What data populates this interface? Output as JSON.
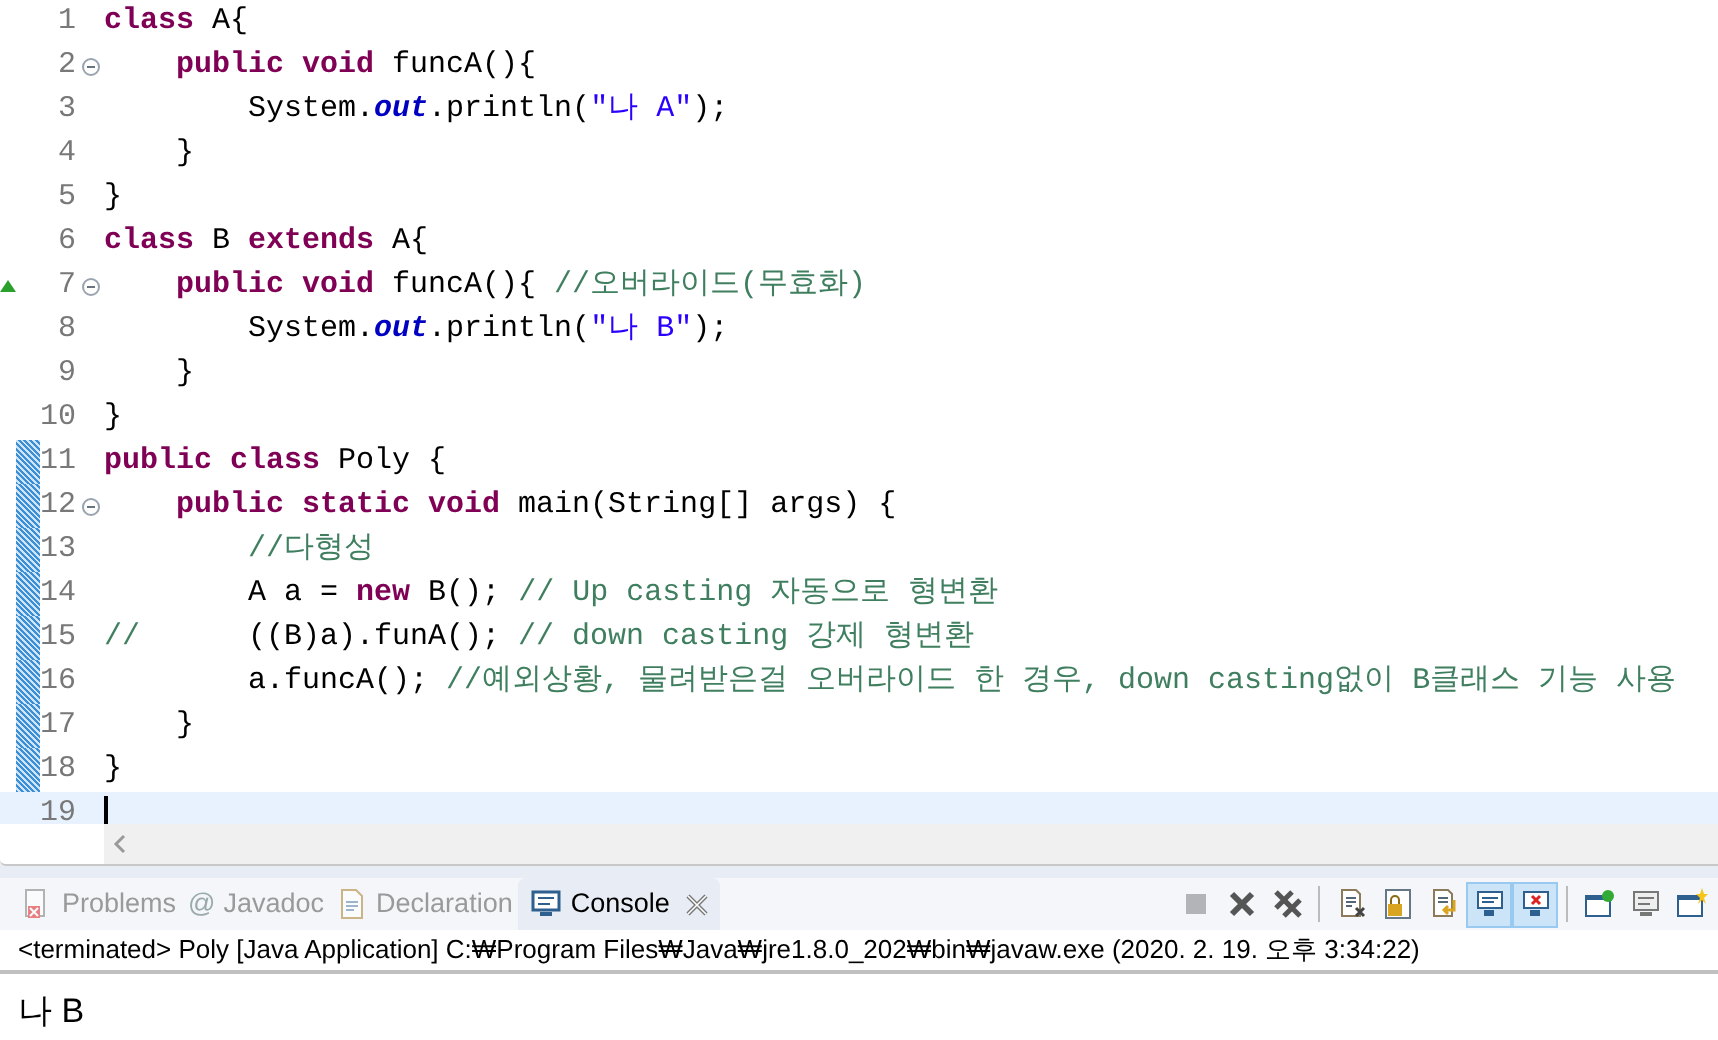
{
  "editor": {
    "lines": [
      {
        "number": "1",
        "fold": false,
        "override": false,
        "changed": false,
        "current": false,
        "tokens": [
          {
            "kind": "keyword",
            "text": "class"
          },
          {
            "kind": "plain",
            "text": " A{"
          }
        ]
      },
      {
        "number": "2",
        "fold": true,
        "override": false,
        "changed": false,
        "current": false,
        "tokens": [
          {
            "kind": "keyword",
            "text": "    public void"
          },
          {
            "kind": "plain",
            "text": " funcA(){"
          }
        ]
      },
      {
        "number": "3",
        "fold": false,
        "override": false,
        "changed": false,
        "current": false,
        "tokens": [
          {
            "kind": "plain",
            "text": "        System."
          },
          {
            "kind": "field",
            "text": "out"
          },
          {
            "kind": "plain",
            "text": ".println("
          },
          {
            "kind": "string",
            "text": "\"나 A\""
          },
          {
            "kind": "plain",
            "text": ");"
          }
        ]
      },
      {
        "number": "4",
        "fold": false,
        "override": false,
        "changed": false,
        "current": false,
        "tokens": [
          {
            "kind": "plain",
            "text": "    }"
          }
        ]
      },
      {
        "number": "5",
        "fold": false,
        "override": false,
        "changed": false,
        "current": false,
        "tokens": [
          {
            "kind": "plain",
            "text": "}"
          }
        ]
      },
      {
        "number": "6",
        "fold": false,
        "override": false,
        "changed": false,
        "current": false,
        "tokens": [
          {
            "kind": "keyword",
            "text": "class"
          },
          {
            "kind": "plain",
            "text": " B "
          },
          {
            "kind": "keyword",
            "text": "extends"
          },
          {
            "kind": "plain",
            "text": " A{"
          }
        ]
      },
      {
        "number": "7",
        "fold": true,
        "override": true,
        "changed": false,
        "current": false,
        "tokens": [
          {
            "kind": "keyword",
            "text": "    public void"
          },
          {
            "kind": "plain",
            "text": " funcA(){ "
          },
          {
            "kind": "comment",
            "text": "//오버라이드(무효화)"
          }
        ]
      },
      {
        "number": "8",
        "fold": false,
        "override": false,
        "changed": false,
        "current": false,
        "tokens": [
          {
            "kind": "plain",
            "text": "        System."
          },
          {
            "kind": "field",
            "text": "out"
          },
          {
            "kind": "plain",
            "text": ".println("
          },
          {
            "kind": "string",
            "text": "\"나 B\""
          },
          {
            "kind": "plain",
            "text": ");"
          }
        ]
      },
      {
        "number": "9",
        "fold": false,
        "override": false,
        "changed": false,
        "current": false,
        "tokens": [
          {
            "kind": "plain",
            "text": "    }"
          }
        ]
      },
      {
        "number": "10",
        "fold": false,
        "override": false,
        "changed": false,
        "current": false,
        "tokens": [
          {
            "kind": "plain",
            "text": "}"
          }
        ]
      },
      {
        "number": "11",
        "fold": false,
        "override": false,
        "changed": true,
        "current": false,
        "tokens": [
          {
            "kind": "keyword",
            "text": "public class"
          },
          {
            "kind": "plain",
            "text": " Poly {"
          }
        ]
      },
      {
        "number": "12",
        "fold": true,
        "override": false,
        "changed": true,
        "current": false,
        "tokens": [
          {
            "kind": "keyword",
            "text": "    public static void"
          },
          {
            "kind": "plain",
            "text": " main(String[] args) {"
          }
        ]
      },
      {
        "number": "13",
        "fold": false,
        "override": false,
        "changed": true,
        "current": false,
        "tokens": [
          {
            "kind": "comment",
            "text": "        //다형성"
          }
        ]
      },
      {
        "number": "14",
        "fold": false,
        "override": false,
        "changed": true,
        "current": false,
        "tokens": [
          {
            "kind": "plain",
            "text": "        A a = "
          },
          {
            "kind": "keyword",
            "text": "new"
          },
          {
            "kind": "plain",
            "text": " B(); "
          },
          {
            "kind": "comment",
            "text": "// Up casting 자동으로 형변환"
          }
        ]
      },
      {
        "number": "15",
        "fold": false,
        "override": false,
        "changed": true,
        "current": false,
        "tokens": [
          {
            "kind": "comment",
            "text": "//"
          },
          {
            "kind": "plain",
            "text": "      ((B)a).funA(); "
          },
          {
            "kind": "comment",
            "text": "// down casting 강제 형변환"
          }
        ]
      },
      {
        "number": "16",
        "fold": false,
        "override": false,
        "changed": true,
        "current": false,
        "tokens": [
          {
            "kind": "plain",
            "text": "        a.funcA(); "
          },
          {
            "kind": "comment",
            "text": "//예외상황, 물려받은걸 오버라이드 한 경우, down casting없이 B클래스 기능 사용"
          }
        ]
      },
      {
        "number": "17",
        "fold": false,
        "override": false,
        "changed": true,
        "current": false,
        "tokens": [
          {
            "kind": "plain",
            "text": "    }"
          }
        ]
      },
      {
        "number": "18",
        "fold": false,
        "override": false,
        "changed": true,
        "current": false,
        "tokens": [
          {
            "kind": "plain",
            "text": "}"
          }
        ]
      },
      {
        "number": "19",
        "fold": false,
        "override": false,
        "changed": false,
        "current": true
      }
    ]
  },
  "console": {
    "tabs": [
      {
        "kind": "problems",
        "label": "Problems",
        "selected": false,
        "closable": false
      },
      {
        "kind": "javadoc",
        "icon": "@",
        "label": "Javadoc",
        "selected": false,
        "closable": false
      },
      {
        "kind": "declaration",
        "label": "Declaration",
        "selected": false,
        "closable": false
      },
      {
        "kind": "console",
        "label": "Console",
        "selected": true,
        "closable": true
      }
    ],
    "toolbar": [
      {
        "kind": "terminate",
        "disabled": true,
        "pressed": false
      },
      {
        "kind": "remove",
        "disabled": false,
        "pressed": false
      },
      {
        "kind": "remove-all",
        "disabled": false,
        "pressed": false
      },
      {
        "kind": "clear",
        "disabled": false,
        "pressed": false
      },
      {
        "kind": "scroll-lock",
        "disabled": false,
        "pressed": false
      },
      {
        "kind": "word-wrap",
        "disabled": false,
        "pressed": false
      },
      {
        "kind": "show-stdout",
        "disabled": false,
        "pressed": true
      },
      {
        "kind": "show-stderr",
        "disabled": false,
        "pressed": true
      },
      {
        "kind": "pin",
        "disabled": false,
        "pressed": false
      },
      {
        "kind": "display",
        "disabled": false,
        "pressed": false
      },
      {
        "kind": "new-console",
        "disabled": false,
        "pressed": false
      }
    ],
    "description": "<terminated> Poly [Java Application] C:₩Program Files₩Java₩jre1.8.0_202₩bin₩javaw.exe (2020. 2. 19. 오후 3:34:22)",
    "output": "나 B"
  }
}
